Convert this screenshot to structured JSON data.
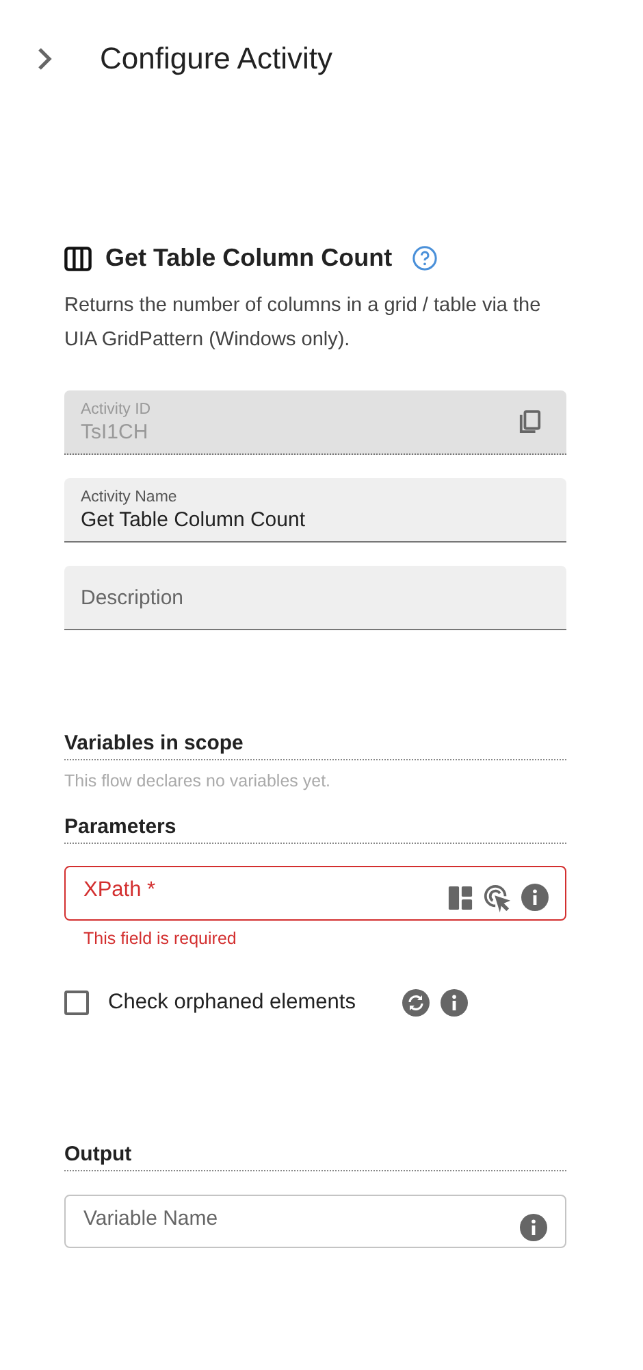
{
  "header": {
    "title": "Configure Activity"
  },
  "activity": {
    "title": "Get Table Column Count",
    "description": "Returns the number of columns in a grid / table via the UIA GridPattern (Windows only)."
  },
  "fields": [
    {
      "label": "Activity ID",
      "value": "TsI1CH",
      "disabled": true
    },
    {
      "label": "Activity Name",
      "value": "Get Table Column Count",
      "disabled": false
    },
    {
      "placeholder": "Description",
      "disabled": false
    }
  ],
  "variables": {
    "heading": "Variables in scope",
    "note": "This flow declares no variables yet."
  },
  "parameters": {
    "heading": "Parameters",
    "xpath": {
      "label": "XPath *",
      "error": "This field is required"
    },
    "orphaned": {
      "label": "Check orphaned elements",
      "checked": false
    }
  },
  "output": {
    "heading": "Output",
    "placeholder": "Variable Name"
  }
}
